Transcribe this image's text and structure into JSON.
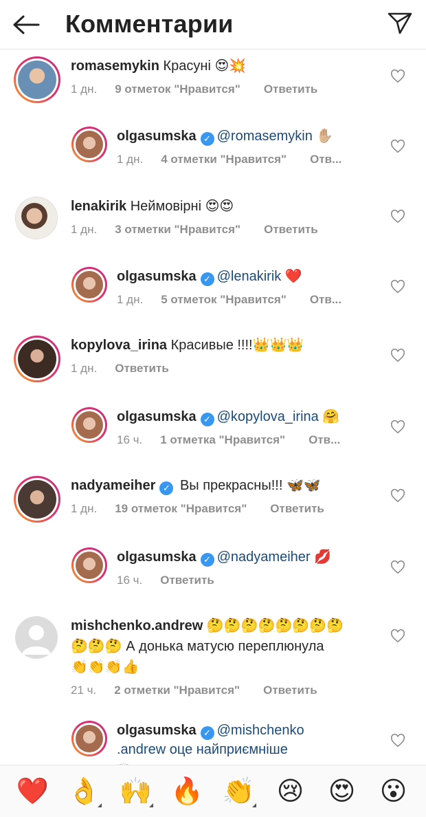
{
  "header": {
    "title": "Комментарии"
  },
  "comments": [
    {
      "username": "romasemykin",
      "text": "Красуні 😍💥",
      "time": "1 дн.",
      "likes": "9 отметок \"Нравится\"",
      "reply": "Ответить",
      "avatar_color": "#6a8fb5"
    },
    {
      "username": "olgasumska",
      "mention": "@romasemykin",
      "text": " ✋🏼",
      "time": "1 дн.",
      "likes": "4 отметки \"Нравится\"",
      "reply": "Отв...",
      "avatar_color": "#b07a62"
    },
    {
      "username": "lenakirik",
      "text": "Неймовірні 😍😍",
      "time": "1 дн.",
      "likes": "3 отметки \"Нравится\"",
      "reply": "Ответить",
      "avatar_color": "#c9a38a"
    },
    {
      "username": "olgasumska",
      "mention": "@lenakirik",
      "text": " ❤️",
      "time": "1 дн.",
      "likes": "5 отметок \"Нравится\"",
      "reply": "Отв...",
      "avatar_color": "#b07a62"
    },
    {
      "username": "kopylova_irina",
      "text": "Красивые !!!!👑👑👑",
      "time": "1 дн.",
      "reply": "Ответить",
      "avatar_color": "#4a3a30"
    },
    {
      "username": "olgasumska",
      "mention": "@kopylova_irina",
      "text": " 🤗",
      "time": "16 ч.",
      "likes": "1 отметка \"Нравится\"",
      "reply": "Отв...",
      "avatar_color": "#b07a62"
    },
    {
      "username": "nadyameiher",
      "text": "Вы прекрасны!!! 🦋🦋",
      "time": "1 дн.",
      "likes": "19 отметок \"Нравится\"",
      "reply": "Ответить",
      "avatar_color": "#5b4b42"
    },
    {
      "username": "olgasumska",
      "mention": "@nadyameiher",
      "text": " 💋",
      "time": "16 ч.",
      "reply": "Ответить",
      "avatar_color": "#b07a62"
    },
    {
      "username": "mishchenko.andrew",
      "line1_emoji": "🤔🤔🤔🤔🤔🤔🤔🤔",
      "line2": "🤔🤔🤔 А донька матусю переплюнула",
      "line3": "👏👏👏👍",
      "time": "21 ч.",
      "likes": "2 отметки \"Нравится\"",
      "reply": "Ответить",
      "avatar_color": "#d8d8d8"
    },
    {
      "username": "olgasumska",
      "mention": "@mishchenko",
      "line2": ".andrew оце найприємніше",
      "line3": "🙌🏼",
      "avatar_color": "#b07a62"
    }
  ],
  "emoji_bar": [
    "❤️",
    "👌",
    "🙌",
    "🔥",
    "👏",
    "😢",
    "😍",
    "😮"
  ],
  "colors": {
    "mention": "#1b4a7a",
    "meta": "#8e8e8e",
    "verified": "#3897f0"
  }
}
